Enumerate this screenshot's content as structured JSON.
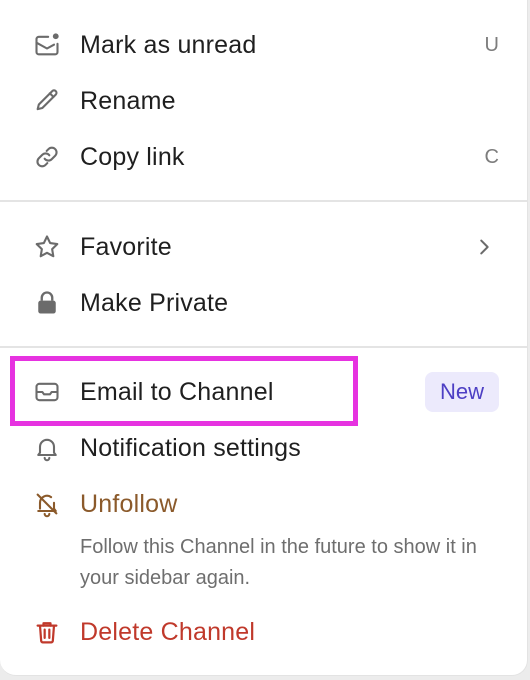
{
  "menu": {
    "items": [
      {
        "label": "Mark as unread",
        "shortcut": "U",
        "icon": "mail-unread-icon"
      },
      {
        "label": "Rename",
        "icon": "pencil-icon"
      },
      {
        "label": "Copy link",
        "shortcut": "C",
        "icon": "link-icon"
      },
      {
        "label": "Favorite",
        "icon": "star-icon",
        "submenu": true
      },
      {
        "label": "Make Private",
        "icon": "lock-icon"
      },
      {
        "label": "Email to Channel",
        "icon": "envelope-icon",
        "badge": "New"
      },
      {
        "label": "Notification settings",
        "icon": "bell-icon"
      },
      {
        "label": "Unfollow",
        "icon": "bell-off-icon",
        "color": "#8b5a2b"
      },
      {
        "label": "Delete Channel",
        "icon": "trash-icon",
        "color": "#c0392b"
      }
    ],
    "unfollow_description": "Follow this Channel in the future to show it in your sidebar again."
  },
  "colors": {
    "highlight": "#e632e0",
    "badge_bg": "#eceafc",
    "badge_text": "#4d3fc4",
    "unfollow": "#8b5a2b",
    "delete": "#c0392b"
  }
}
